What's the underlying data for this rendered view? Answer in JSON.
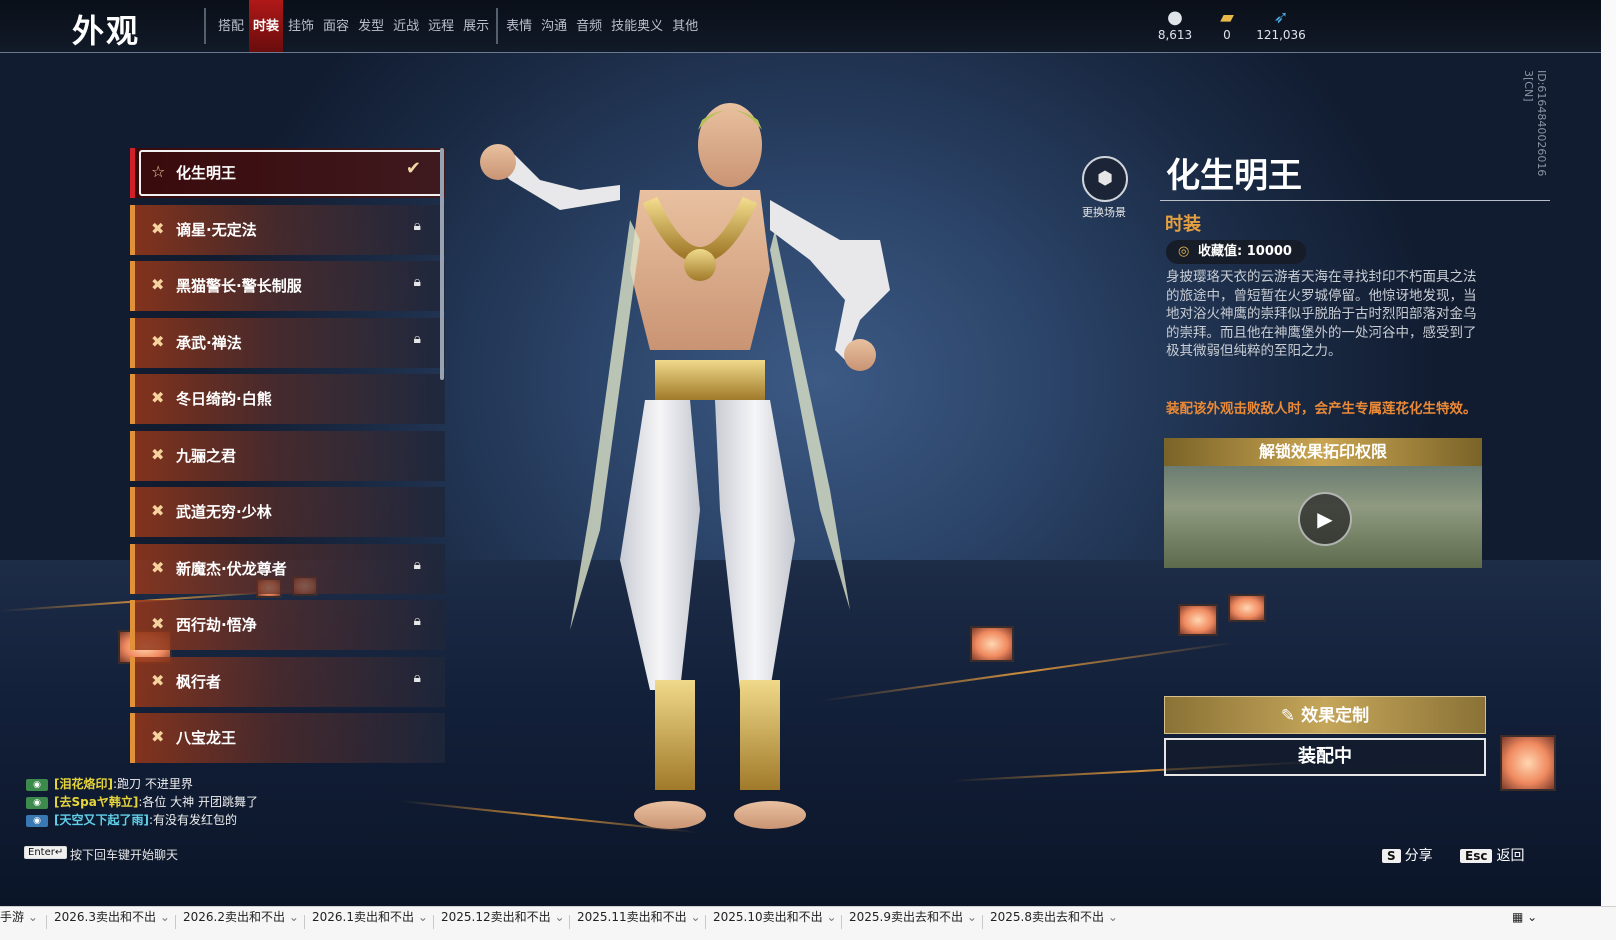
{
  "header": {
    "title": "外观",
    "tabs": [
      "搭配",
      "时装",
      "挂饰",
      "面容",
      "发型",
      "近战",
      "远程",
      "展示",
      "表情",
      "沟通",
      "音频",
      "技能奥义",
      "其他"
    ],
    "active_tab": "时装",
    "currencies": [
      {
        "icon": "coin-icon",
        "value": "8,613"
      },
      {
        "icon": "ticket-icon",
        "value": "0"
      },
      {
        "icon": "feather-icon",
        "value": "121,036"
      }
    ]
  },
  "outfit_list": {
    "items": [
      {
        "label": "化生明王",
        "status": "selected"
      },
      {
        "label": "谪星·无定法",
        "status": "locked"
      },
      {
        "label": "黑猫警长·警长制服",
        "status": "locked"
      },
      {
        "label": "承武·禅法",
        "status": "locked"
      },
      {
        "label": "冬日绮韵·白熊",
        "status": "owned"
      },
      {
        "label": "九骊之君",
        "status": "owned"
      },
      {
        "label": "武道无穷·少林",
        "status": "owned"
      },
      {
        "label": "新魔杰·伏龙尊者",
        "status": "locked"
      },
      {
        "label": "西行劫·悟净",
        "status": "locked"
      },
      {
        "label": "枫行者",
        "status": "locked"
      },
      {
        "label": "八宝龙王",
        "status": "owned"
      }
    ]
  },
  "detail": {
    "scene_label": "更换场景",
    "name": "化生明王",
    "category": "时装",
    "collect_label": "收藏值: 10000",
    "description": "身披璎珞天衣的云游者天海在寻找封印不朽面具之法的旅途中，曾短暂在火罗城停留。他惊讶地发现，当地对浴火神鹰的崇拜似乎脱胎于古时烈阳部落对金乌的崇拜。而且他在神鹰堡外的一处河谷中，感受到了极其微弱但纯粹的至阳之力。",
    "effect_text": "装配该外观击败敌人时，会产生专属莲花化生特效。",
    "unlock_title": "解锁效果拓印权限",
    "customize_button": "效果定制",
    "equip_button": "装配中"
  },
  "chat": {
    "messages": [
      {
        "channel": "world",
        "name": "[泪花烙印]",
        "text": ":跑刀  不进里界"
      },
      {
        "channel": "world",
        "name": "[去Spaヤ韩立]",
        "text": ":各位 大神 开团跳舞了"
      },
      {
        "channel": "team",
        "name": "[天空又下起了雨]",
        "text": ":有没有发红包的"
      }
    ],
    "enter_key": "Enter↵",
    "hint": "按下回车键开始聊天"
  },
  "hotkeys": {
    "share_key": "S",
    "share_label": "分享",
    "back_key": "Esc",
    "back_label": "返回"
  },
  "side_id": "ID:6164840026016 3[CN]",
  "bottom_tabs": [
    "手游",
    "2026.3卖出和不出",
    "2026.2卖出和不出",
    "2026.1卖出和不出",
    "2025.12卖出和不出",
    "2025.11卖出和不出",
    "2025.10卖出和不出",
    "2025.9卖出去和不出",
    "2025.8卖出去和不出"
  ]
}
